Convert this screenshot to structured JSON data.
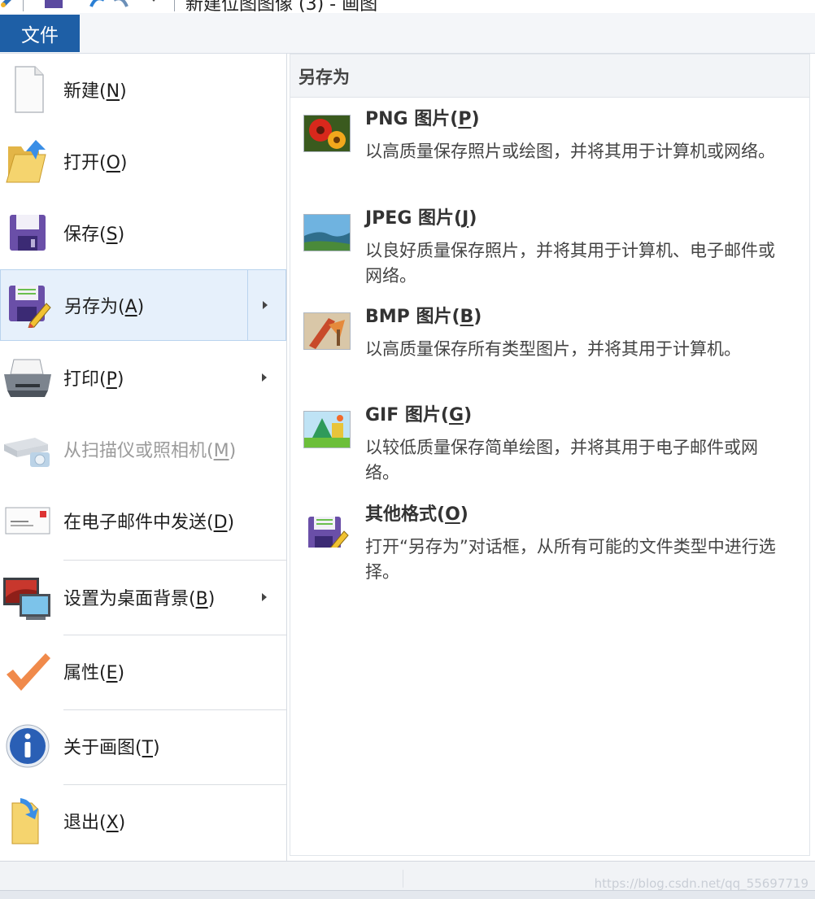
{
  "titlebar": {
    "title": "新建位图图像 (3) - 画图"
  },
  "ribbon": {
    "file_tab": "文件"
  },
  "left_menu": {
    "new": {
      "label": "新建(",
      "key": "N",
      "end": ")"
    },
    "open": {
      "label": "打开(",
      "key": "O",
      "end": ")"
    },
    "save": {
      "label": "保存(",
      "key": "S",
      "end": ")"
    },
    "save_as": {
      "label": "另存为(",
      "key": "A",
      "end": ")"
    },
    "print": {
      "label": "打印(",
      "key": "P",
      "end": ")"
    },
    "from_scanner": {
      "label": "从扫描仪或照相机(",
      "key": "M",
      "end": ")"
    },
    "send_email": {
      "label": "在电子邮件中发送(",
      "key": "D",
      "end": ")"
    },
    "set_desktop": {
      "label": "设置为桌面背景(",
      "key": "B",
      "end": ")"
    },
    "properties": {
      "label": "属性(",
      "key": "E",
      "end": ")"
    },
    "about": {
      "label": "关于画图(",
      "key": "T",
      "end": ")"
    },
    "exit": {
      "label": "退出(",
      "key": "X",
      "end": ")"
    }
  },
  "save_as_pane": {
    "header": "另存为",
    "options": {
      "png": {
        "title": "PNG 图片(",
        "key": "P",
        "end": ")",
        "description": "以高质量保存照片或绘图，并将其用于计算机或网络。"
      },
      "jpeg": {
        "title": "JPEG 图片(",
        "key": "J",
        "end": ")",
        "description": "以良好质量保存照片，并将其用于计算机、电子邮件或网络。"
      },
      "bmp": {
        "title": "BMP 图片(",
        "key": "B",
        "end": ")",
        "description": "以高质量保存所有类型图片，并将其用于计算机。"
      },
      "gif": {
        "title": "GIF 图片(",
        "key": "G",
        "end": ")",
        "description": "以较低质量保存简单绘图，并将其用于电子邮件或网络。"
      },
      "other": {
        "title": "其他格式(",
        "key": "O",
        "end": ")",
        "description": "打开“另存为”对话框，从所有可能的文件类型中进行选择。"
      }
    }
  },
  "statusbar": {
    "watermark": "https://blog.csdn.net/qq_55697719"
  },
  "colors": {
    "file_tab_bg": "#1e5fa6",
    "selected_item_bg": "#e6f0fb",
    "disabled_text": "#9b9b9b"
  },
  "icons": {
    "new": "blank-document-icon",
    "open": "open-folder-icon",
    "save": "floppy-disk-icon",
    "save_as": "save-as-icon",
    "print": "printer-icon",
    "from_scanner": "scanner-camera-icon",
    "send_email": "email-envelope-icon",
    "set_desktop": "desktop-background-icon",
    "properties": "checkmark-icon",
    "about": "info-icon",
    "exit": "exit-icon"
  }
}
